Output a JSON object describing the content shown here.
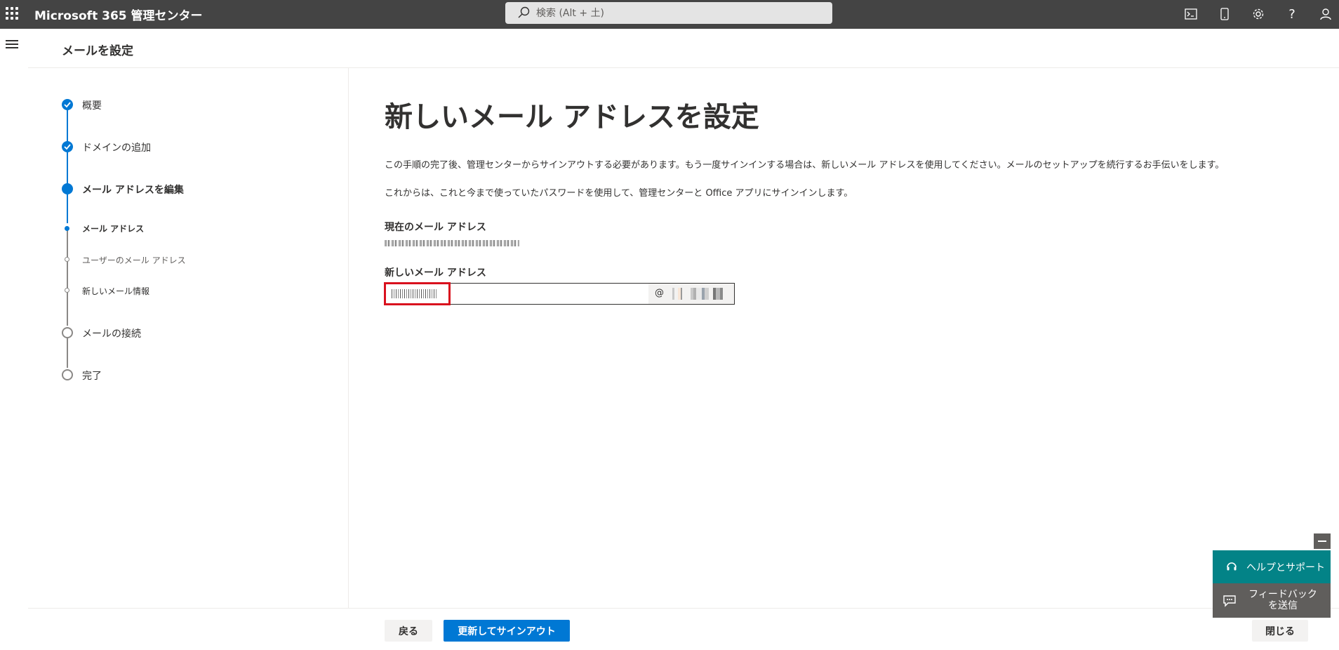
{
  "topbar": {
    "app_title": "Microsoft 365 管理センター",
    "search_placeholder": "検索 (Alt + 土)"
  },
  "page": {
    "title": "メールを設定"
  },
  "stepper": {
    "steps": [
      {
        "label": "概要",
        "state": "done"
      },
      {
        "label": "ドメインの追加",
        "state": "done"
      },
      {
        "label": "メール アドレスを編集",
        "state": "current"
      },
      {
        "label": "メールの接続",
        "state": "pending"
      },
      {
        "label": "完了",
        "state": "pending"
      }
    ],
    "substeps": [
      {
        "label": "メール アドレス",
        "state": "current"
      },
      {
        "label": "ユーザーのメール アドレス",
        "state": "pending"
      },
      {
        "label": "新しいメール情報",
        "state": "pending"
      }
    ]
  },
  "main": {
    "heading": "新しいメール アドレスを設定",
    "paragraph1": "この手順の完了後、管理センターからサインアウトする必要があります。もう一度サインインする場合は、新しいメール アドレスを使用してください。メールのセットアップを続行するお手伝いをします。",
    "paragraph2": "これからは、これと今まで使っていたパスワードを使用して、管理センターと Office アプリにサインインします。",
    "current_email_label": "現在のメール アドレス",
    "new_email_label": "新しいメール アドレス",
    "at_sign": "@"
  },
  "footer": {
    "back_label": "戻る",
    "update_label": "更新してサインアウト",
    "close_label": "閉じる"
  },
  "help": {
    "help_label": "ヘルプとサポート",
    "feedback_line1": "フィードバック",
    "feedback_line2": "を送信"
  },
  "colors": {
    "accent": "#0078d4",
    "topbar": "#444444",
    "help_teal": "#038387",
    "highlight_red": "#d9111e"
  }
}
